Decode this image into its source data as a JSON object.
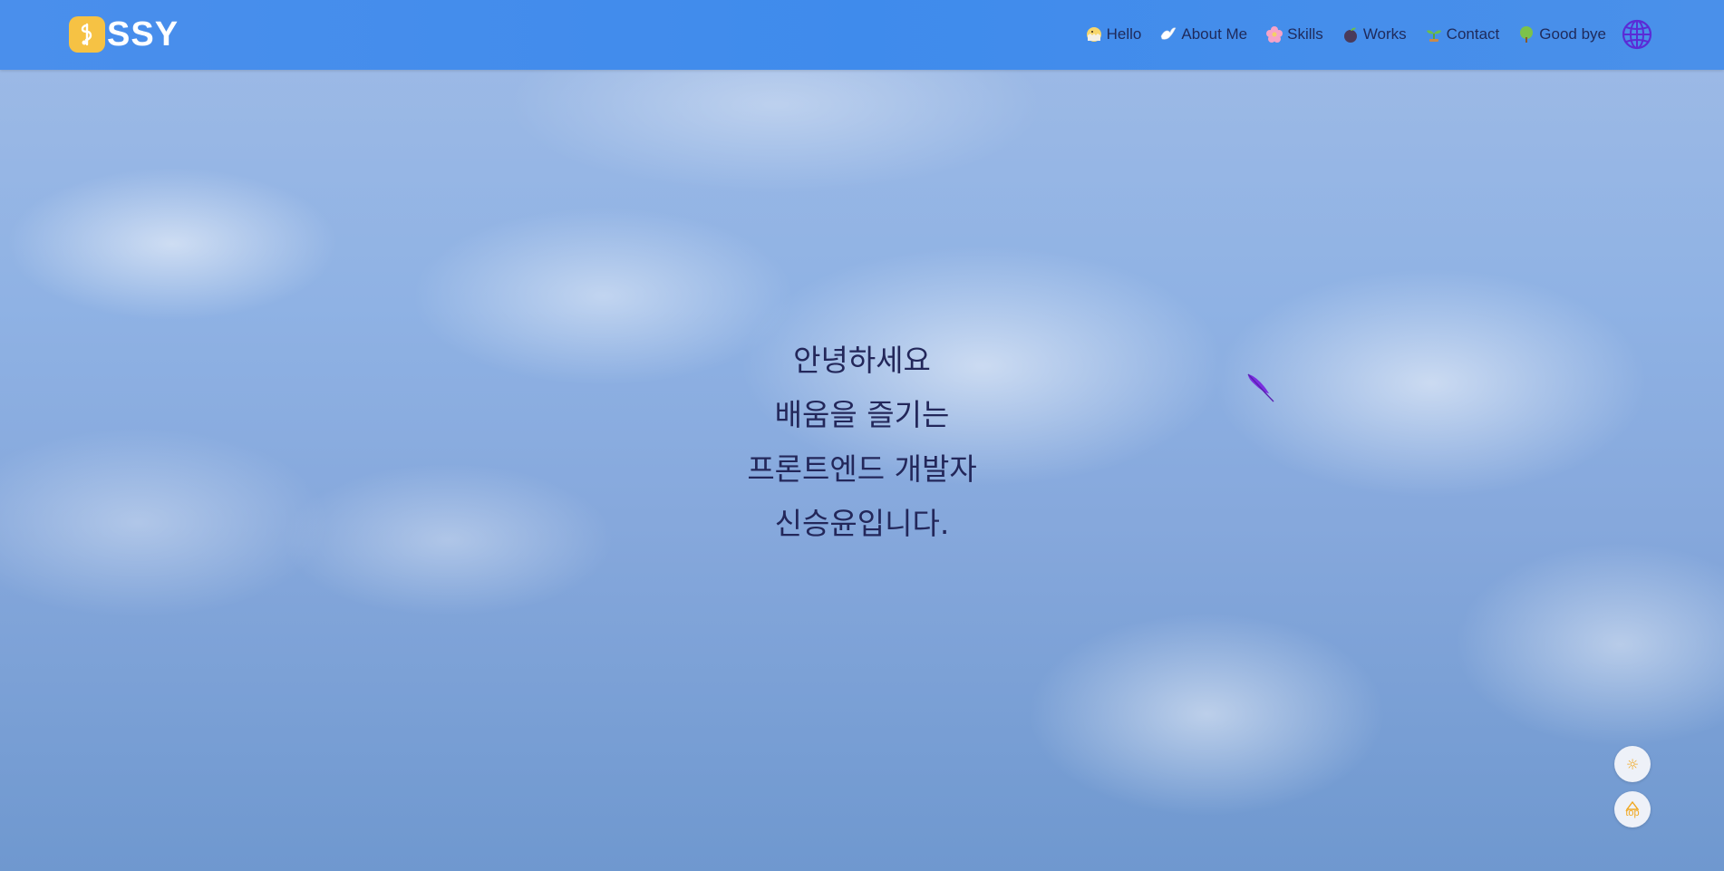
{
  "brand": {
    "logo_text": "SSY",
    "logo_icon": "music-note-badge-icon",
    "accent": "#f6c244"
  },
  "nav": {
    "items": [
      {
        "label": "Hello",
        "icon": "chick-icon"
      },
      {
        "label": "About Me",
        "icon": "dove-icon"
      },
      {
        "label": "Skills",
        "icon": "flower-icon"
      },
      {
        "label": "Works",
        "icon": "seedling-dark-icon"
      },
      {
        "label": "Contact",
        "icon": "sprout-icon"
      },
      {
        "label": "Good bye",
        "icon": "tree-icon"
      }
    ],
    "language_icon": "globe-icon",
    "background": "#4a8fec",
    "text_color": "#1f2a5a"
  },
  "hero": {
    "lines": [
      "안녕하세요",
      "배움을 즐기는",
      "프론트엔드 개발자",
      "신승윤입니다."
    ],
    "text_color": "#23275a"
  },
  "decoration": {
    "feather_icon": "purple-feather-icon"
  },
  "floating_buttons": {
    "theme_icon": "sun-icon",
    "top_label": "top",
    "top_icon": "triangle-up-icon",
    "accent": "#f0a71f"
  }
}
